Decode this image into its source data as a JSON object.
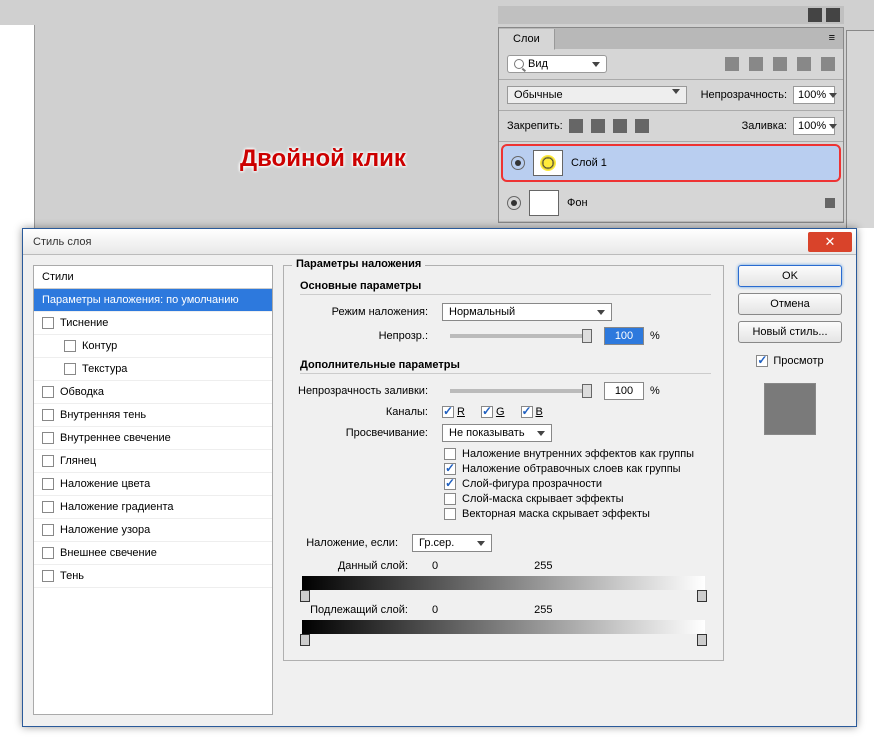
{
  "callout": "Двойной клик",
  "layers_panel": {
    "tab": "Слои",
    "search_placeholder": "Вид",
    "blend_mode": "Обычные",
    "opacity_label": "Непрозрачность:",
    "opacity_value": "100%",
    "lock_label": "Закрепить:",
    "fill_label": "Заливка:",
    "fill_value": "100%",
    "layers": [
      {
        "name": "Слой 1",
        "selected": true
      },
      {
        "name": "Фон",
        "selected": false
      }
    ]
  },
  "dialog": {
    "title": "Стиль слоя",
    "styles_header": "Стили",
    "styles": [
      {
        "label": "Параметры наложения: по умолчанию",
        "selected": true,
        "has_checkbox": false
      },
      {
        "label": "Тиснение",
        "selected": false,
        "has_checkbox": true
      },
      {
        "label": "Контур",
        "selected": false,
        "has_checkbox": true,
        "indent": true
      },
      {
        "label": "Текстура",
        "selected": false,
        "has_checkbox": true,
        "indent": true
      },
      {
        "label": "Обводка",
        "selected": false,
        "has_checkbox": true
      },
      {
        "label": "Внутренняя тень",
        "selected": false,
        "has_checkbox": true
      },
      {
        "label": "Внутреннее свечение",
        "selected": false,
        "has_checkbox": true
      },
      {
        "label": "Глянец",
        "selected": false,
        "has_checkbox": true
      },
      {
        "label": "Наложение цвета",
        "selected": false,
        "has_checkbox": true
      },
      {
        "label": "Наложение градиента",
        "selected": false,
        "has_checkbox": true
      },
      {
        "label": "Наложение узора",
        "selected": false,
        "has_checkbox": true
      },
      {
        "label": "Внешнее свечение",
        "selected": false,
        "has_checkbox": true
      },
      {
        "label": "Тень",
        "selected": false,
        "has_checkbox": true
      }
    ],
    "blending": {
      "title": "Параметры наложения",
      "general_title": "Основные параметры",
      "mode_label": "Режим наложения:",
      "mode_value": "Нормальный",
      "opacity_label": "Непрозр.:",
      "opacity_value": "100",
      "percent": "%",
      "advanced_title": "Дополнительные параметры",
      "fill_opacity_label": "Непрозрачность заливки:",
      "fill_opacity_value": "100",
      "channels_label": "Каналы:",
      "ch_r": "R",
      "ch_g": "G",
      "ch_b": "B",
      "knockout_label": "Просвечивание:",
      "knockout_value": "Не показывать",
      "adv_checks": [
        {
          "label": "Наложение внутренних эффектов как группы",
          "checked": false
        },
        {
          "label": "Наложение обтравочных слоев как группы",
          "checked": true
        },
        {
          "label": "Слой-фигура прозрачности",
          "checked": true
        },
        {
          "label": "Слой-маска скрывает эффекты",
          "checked": false
        },
        {
          "label": "Векторная маска скрывает эффекты",
          "checked": false
        }
      ],
      "blendif_label": "Наложение, если:",
      "blendif_value": "Гр.сер.",
      "this_layer_label": "Данный слой:",
      "this_low": "0",
      "this_high": "255",
      "under_layer_label": "Подлежащий слой:",
      "under_low": "0",
      "under_high": "255"
    },
    "buttons": {
      "ok": "OK",
      "cancel": "Отмена",
      "new_style": "Новый стиль...",
      "preview": "Просмотр"
    }
  }
}
